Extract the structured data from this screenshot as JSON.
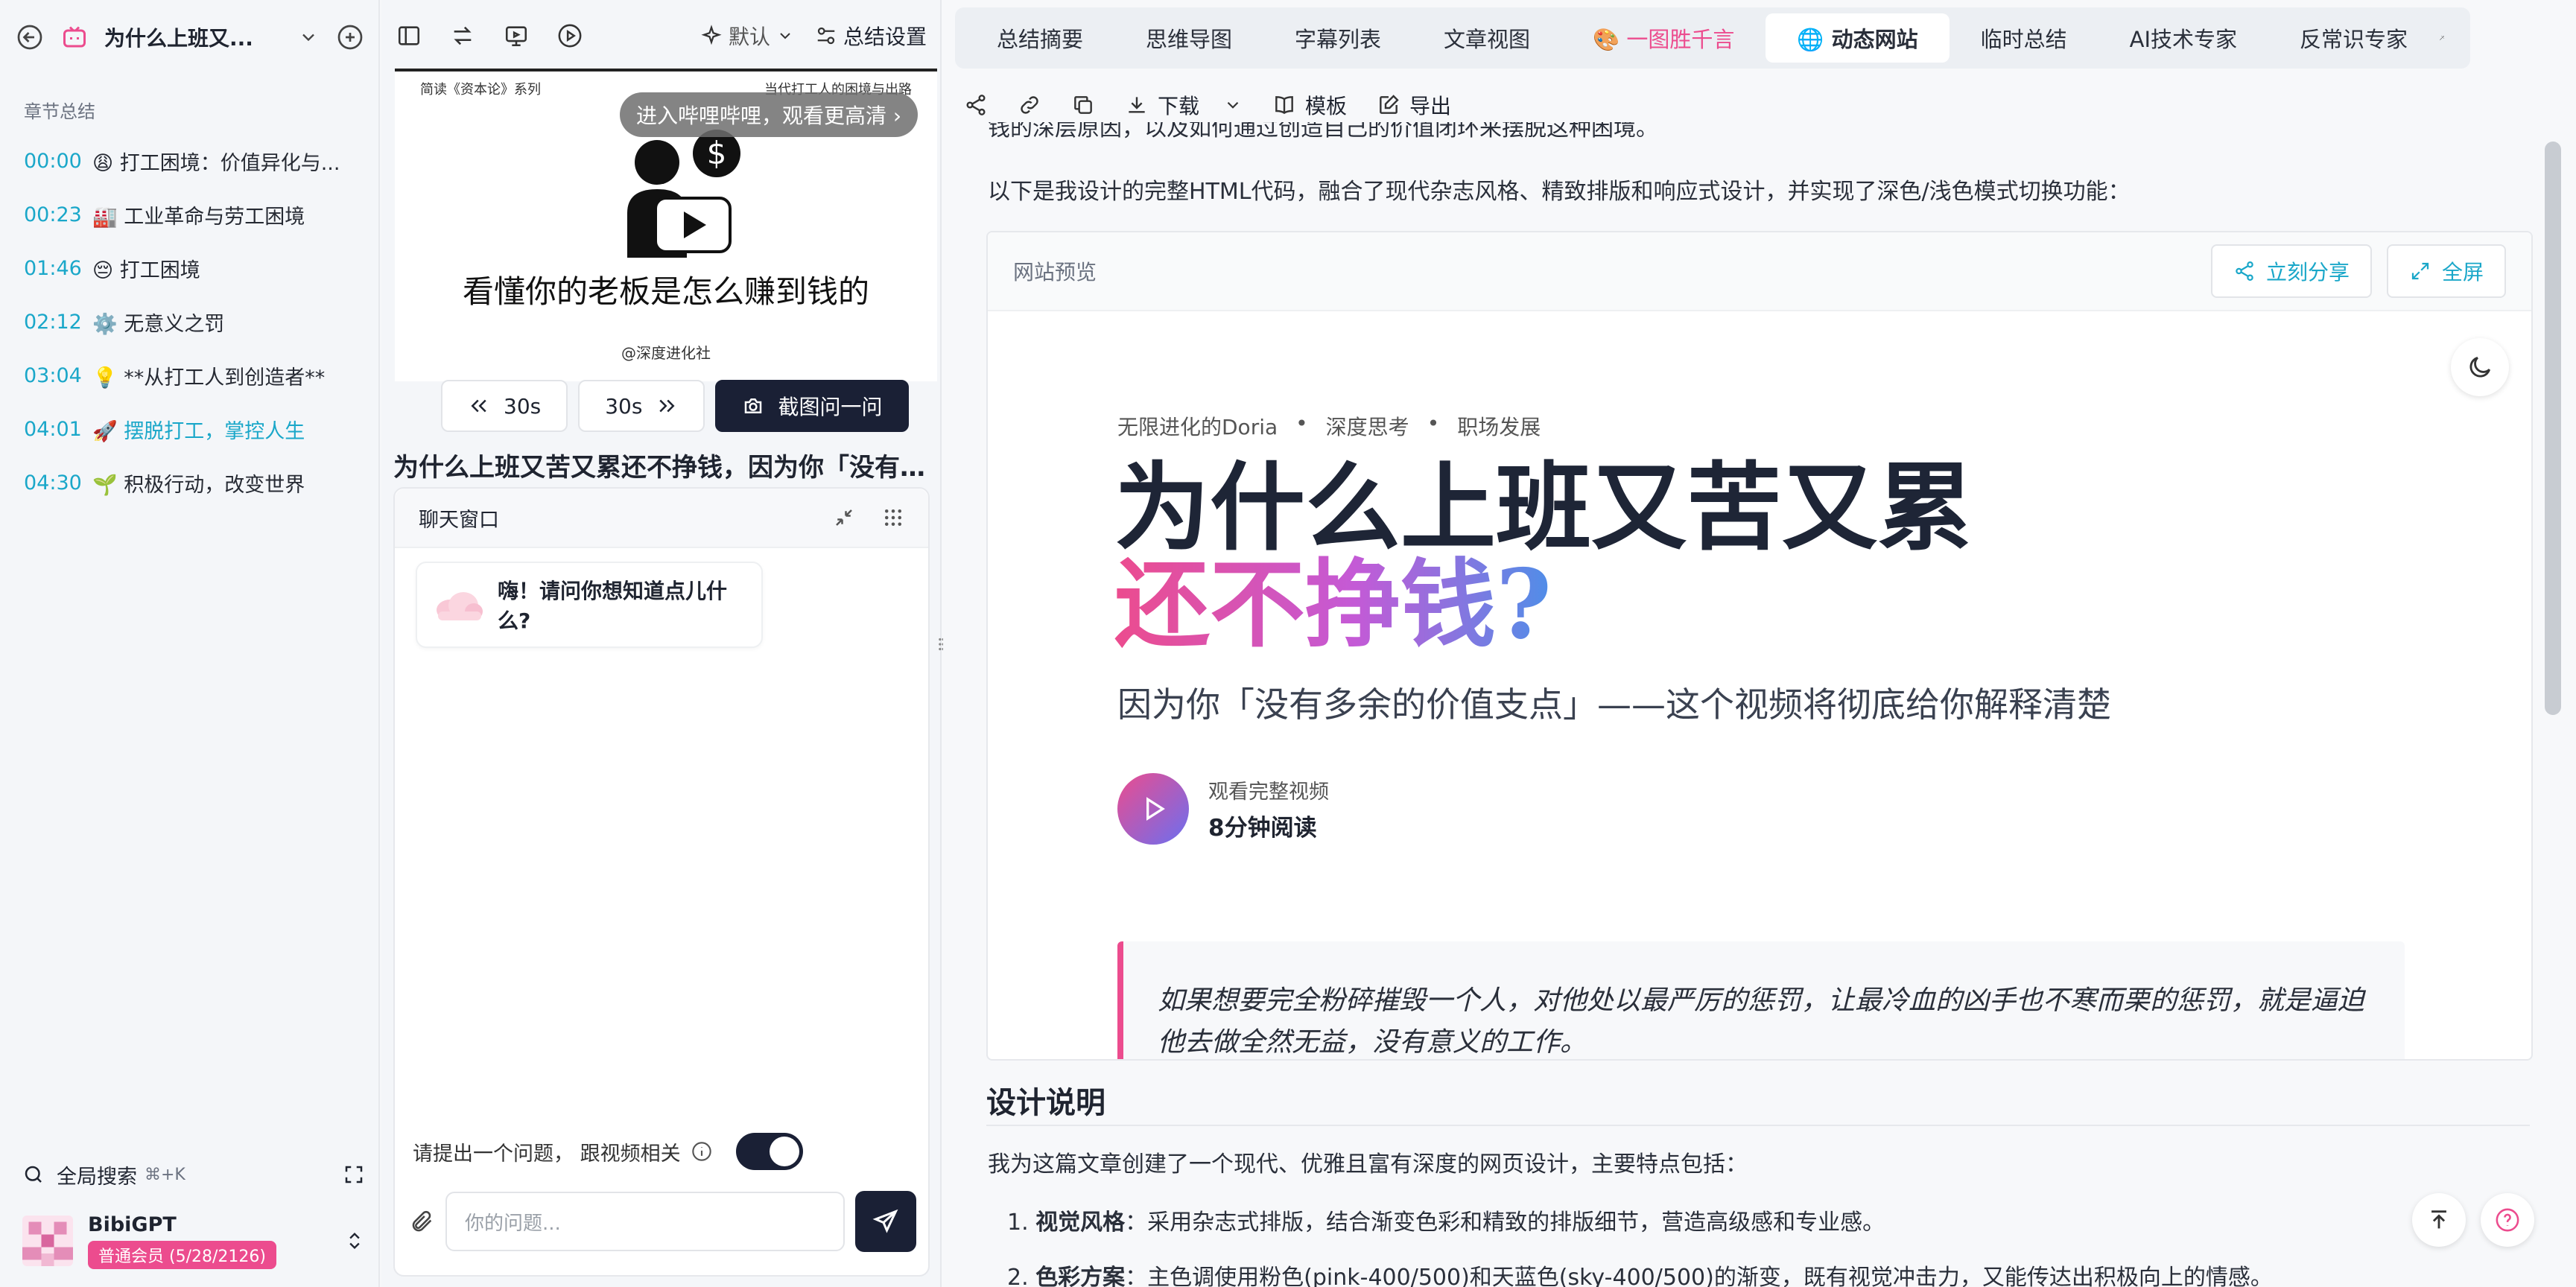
{
  "sidebar": {
    "title": "为什么上班又...",
    "section_label": "章节总结",
    "chapters": [
      {
        "time": "00:00",
        "label": "😩 打工困境：价值异化与..."
      },
      {
        "time": "00:23",
        "label": "🏭 工业革命与劳工困境"
      },
      {
        "time": "01:46",
        "label": "😔 打工困境"
      },
      {
        "time": "02:12",
        "label": "⚙️ 无意义之罚"
      },
      {
        "time": "03:04",
        "label": "💡 **从打工人到创造者**"
      },
      {
        "time": "04:01",
        "label": "🚀 摆脱打工，掌控人生"
      },
      {
        "time": "04:30",
        "label": "🌱 积极行动，改变世界"
      }
    ],
    "search_label": "全局搜索",
    "search_shortcut": "⌘+K",
    "user_name": "BibiGPT",
    "user_badge": "普通会员 (5/28/2126)"
  },
  "middle": {
    "preset_label": "默认",
    "settings_label": "总结设置",
    "video": {
      "corner_left": "简读《资本论》系列",
      "corner_right": "当代打工人的困境与出路",
      "overlay_pill": "进入哔哩哔哩，观看更高清 ›",
      "caption": "看懂你的老板是怎么赚到钱的",
      "credit": "@深度进化社"
    },
    "back_label": "30s",
    "fwd_label": "30s",
    "screenshot_label": "截图问一问",
    "heading": "为什么上班又苦又累还不挣钱，因为你「没有多余的价值支点」",
    "chat": {
      "title": "聊天窗口",
      "greeting": "嗨！请问你想知道点儿什么?",
      "option_label": "请提出一个问题， 跟视频相关",
      "input_placeholder": "你的问题..."
    }
  },
  "right": {
    "tabs": [
      {
        "label": "总结摘要",
        "style": ""
      },
      {
        "label": "思维导图",
        "style": ""
      },
      {
        "label": "字幕列表",
        "style": ""
      },
      {
        "label": "文章视图",
        "style": ""
      },
      {
        "label": "🎨 一图胜千言",
        "style": "pink"
      },
      {
        "label": "🌐 动态网站",
        "style": "active"
      },
      {
        "label": "临时总结",
        "style": ""
      },
      {
        "label": "AI技术专家",
        "style": "ai"
      },
      {
        "label": "反常识专家",
        "style": ""
      }
    ],
    "actions": {
      "download": "下载",
      "template": "模板",
      "export": "导出"
    },
    "cut_line": "钱的深层原因，以及如何通过创造自己的价值闭环来摆脱这种困境。",
    "intro_line": "以下是我设计的完整HTML代码，融合了现代杂志风格、精致排版和响应式设计，并实现了深色/浅色模式切换功能：",
    "preview": {
      "label": "网站预览",
      "share_label": "立刻分享",
      "fullscreen_label": "全屏",
      "meta": [
        "无限进化的Doria",
        "•",
        "深度思考",
        "•",
        "职场发展"
      ],
      "title_line1": "为什么上班又苦又累",
      "title_line2": "还不挣钱?",
      "subtitle": "因为你「没有多余的价值支点」——这个视频将彻底给你解释清楚",
      "watch_label": "观看完整视频",
      "read_time": "8分钟阅读",
      "quote_line1": "如果想要完全粉碎摧毁一个人，对他处以最严厉的惩罚，让最冷血的凶手也不寒而栗的惩罚，就是逼迫",
      "quote_line2": "他去做全然无益，没有意义的工作。"
    },
    "design_title": "设计说明",
    "design_intro": "我为这篇文章创建了一个现代、优雅且富有深度的网页设计，主要特点包括：",
    "list": [
      {
        "num": "1.",
        "bold": "视觉风格",
        "text": "：采用杂志式排版，结合渐变色彩和精致的排版细节，营造高级感和专业感。"
      },
      {
        "num": "2.",
        "bold": "色彩方案",
        "text": "：主色调使用粉色(pink-400/500)和天蓝色(sky-400/500)的渐变，既有视觉冲击力，又能传达出积极向上的情感。"
      }
    ],
    "colors": {
      "accent_pink": "#ec4c8e",
      "accent_cyan": "#1aa7c9",
      "dark": "#1a2035"
    }
  }
}
